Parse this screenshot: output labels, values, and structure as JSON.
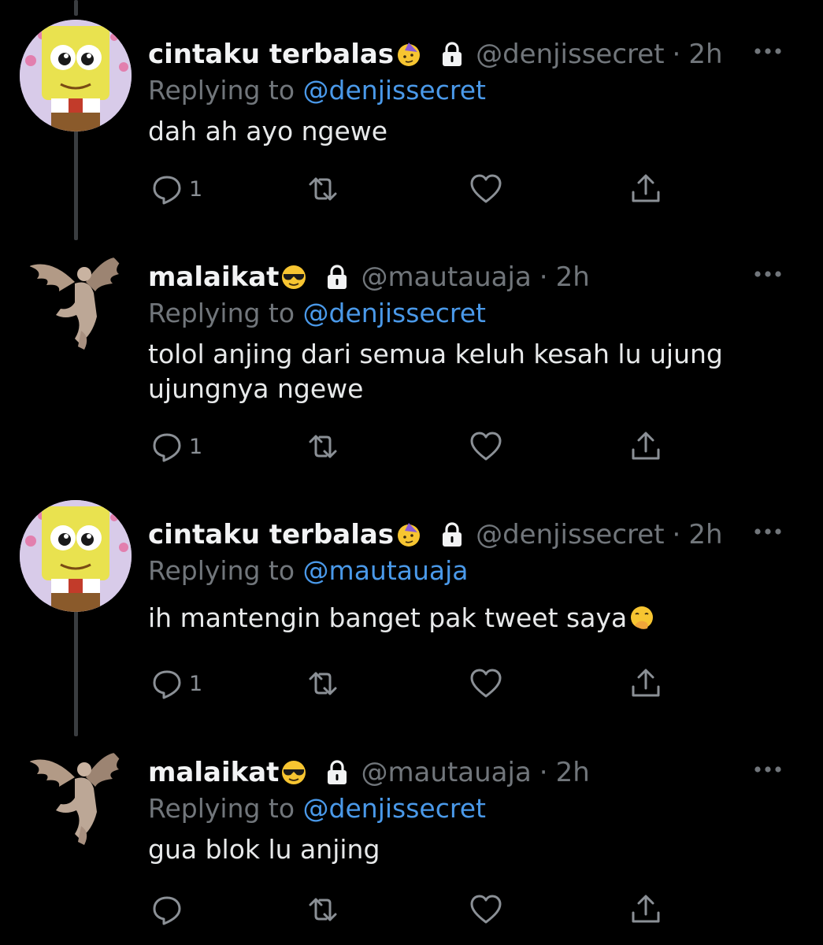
{
  "tweets": [
    {
      "name": "cintaku terbalas",
      "name_emoji": "partying-face",
      "handle": "@denjissecret",
      "time": "2h",
      "replying_label": "Replying to",
      "replying_to": "@denjissecret",
      "text_lines": [
        "dah ah ayo ngewe"
      ],
      "reply_count": "1",
      "avatar": "spongebob"
    },
    {
      "name": "malaikat",
      "name_emoji": "sunglasses-face",
      "handle": "@mautauaja",
      "time": "2h",
      "replying_label": "Replying to",
      "replying_to": "@denjissecret",
      "text_lines": [
        "tolol anjing dari semua keluh kesah lu ujung",
        "ujungnya ngewe"
      ],
      "reply_count": "1",
      "avatar": "angel-statue"
    },
    {
      "name": "cintaku terbalas",
      "name_emoji": "partying-face",
      "handle": "@denjissecret",
      "time": "2h",
      "replying_label": "Replying to",
      "replying_to": "@mautauaja",
      "text_lines": [
        "ih mantengin banget pak tweet saya"
      ],
      "text_emoji": "hand-over-mouth-face",
      "reply_count": "1",
      "avatar": "spongebob"
    },
    {
      "name": "malaikat",
      "name_emoji": "sunglasses-face",
      "handle": "@mautauaja",
      "time": "2h",
      "replying_label": "Replying to",
      "replying_to": "@denjissecret",
      "text_lines": [
        "gua blok lu anjing"
      ],
      "reply_count": "",
      "avatar": "angel-statue"
    }
  ],
  "separator": "·",
  "icons": [
    "reply-icon",
    "retweet-icon",
    "like-icon",
    "share-icon",
    "more-icon",
    "lock-icon"
  ],
  "colors": {
    "background": "#000000",
    "text": "#e7e9ea",
    "muted": "#71767b",
    "link": "#4a99e9",
    "thread_line": "#3a3d40"
  }
}
